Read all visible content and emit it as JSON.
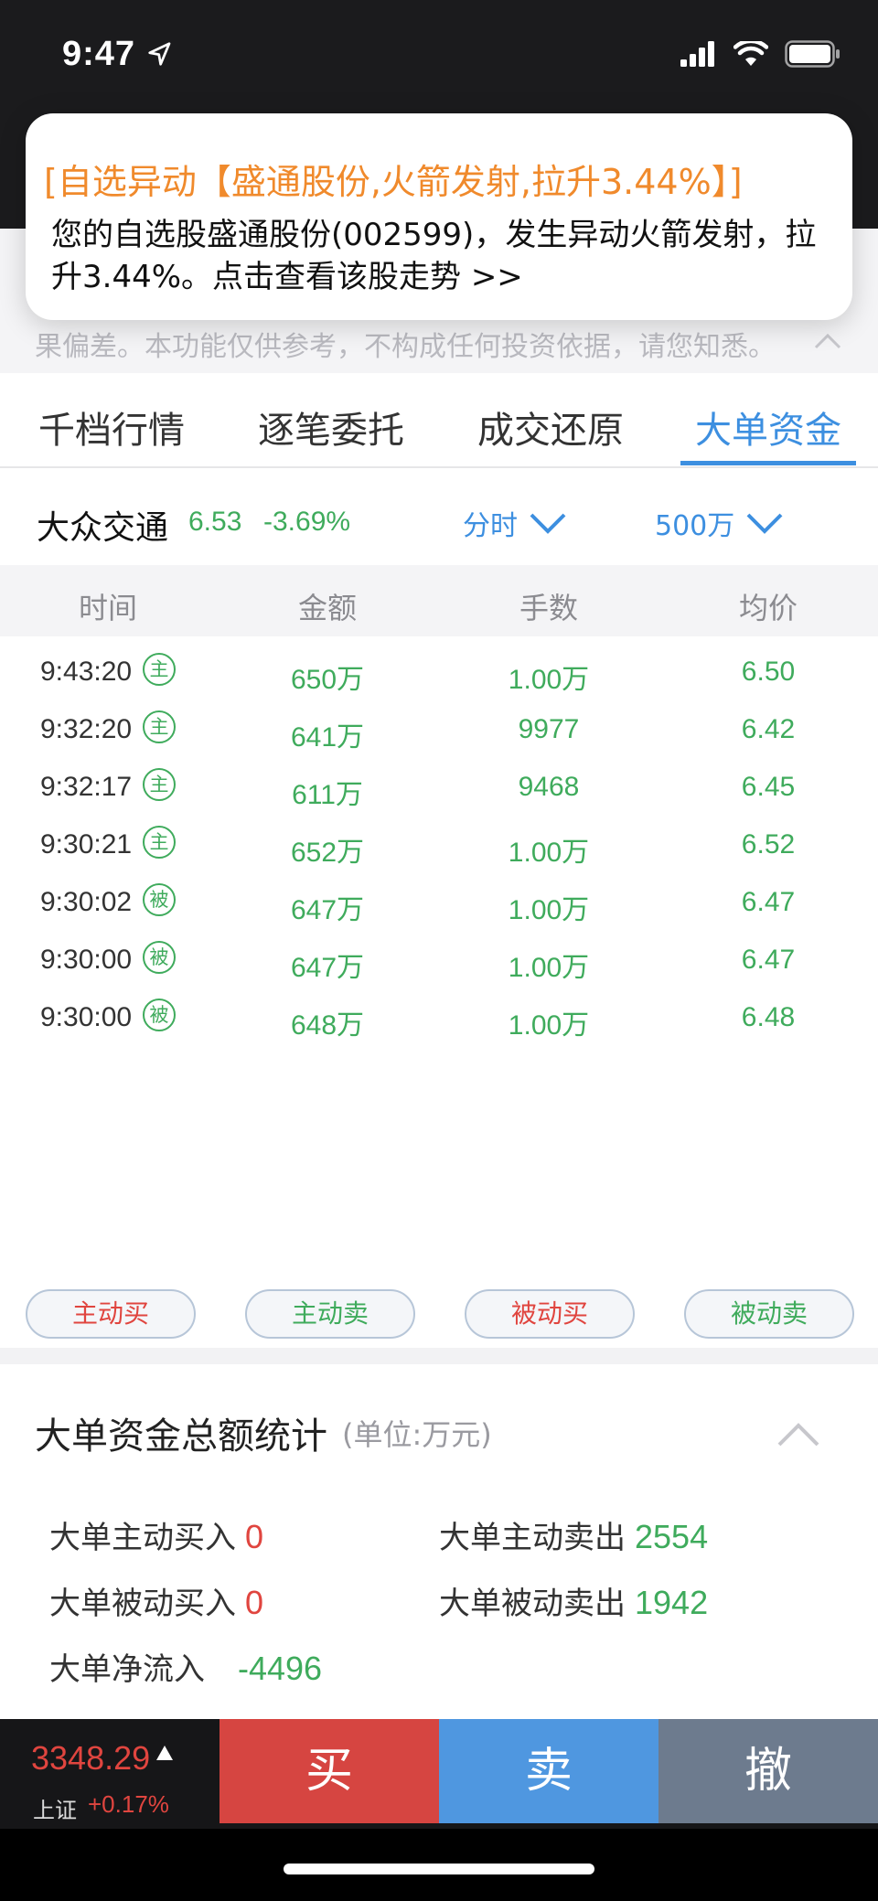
{
  "status_bar": {
    "time": "9:47"
  },
  "notification": {
    "title": "[自选异动【盛通股份,火箭发射,拉升3.44%】]",
    "body": "您的自选股盛通股份(002599)，发生异动火箭发射，拉升3.44%。点击查看该股走势 >>"
  },
  "disclaimer": "果偏差。本功能仅供参考，不构成任何投资依据，请您知悉。",
  "tabs": [
    {
      "label": "千档行情",
      "active": false
    },
    {
      "label": "逐笔委托",
      "active": false
    },
    {
      "label": "成交还原",
      "active": false
    },
    {
      "label": "大单资金",
      "active": true
    }
  ],
  "stock": {
    "name": "大众交通",
    "price": "6.53",
    "change": "-3.69%",
    "period_select": "分时",
    "threshold_select": "500万"
  },
  "table": {
    "headers": [
      "时间",
      "金额",
      "手数",
      "均价"
    ],
    "rows": [
      {
        "time": "9:43:20",
        "tag": "主",
        "amount": "650万",
        "lots": "1.00万",
        "avg": "6.50"
      },
      {
        "time": "9:32:20",
        "tag": "主",
        "amount": "641万",
        "lots": "9977",
        "avg": "6.42"
      },
      {
        "time": "9:32:17",
        "tag": "主",
        "amount": "611万",
        "lots": "9468",
        "avg": "6.45"
      },
      {
        "time": "9:30:21",
        "tag": "主",
        "amount": "652万",
        "lots": "1.00万",
        "avg": "6.52"
      },
      {
        "time": "9:30:02",
        "tag": "被",
        "amount": "647万",
        "lots": "1.00万",
        "avg": "6.47"
      },
      {
        "time": "9:30:00",
        "tag": "被",
        "amount": "647万",
        "lots": "1.00万",
        "avg": "6.47"
      },
      {
        "time": "9:30:00",
        "tag": "被",
        "amount": "648万",
        "lots": "1.00万",
        "avg": "6.48"
      }
    ]
  },
  "legend": {
    "active_buy": "主动买",
    "active_sell": "主动卖",
    "passive_buy": "被动买",
    "passive_sell": "被动卖"
  },
  "summary": {
    "title": "大单资金总额统计",
    "unit": "(单位:万元)",
    "active_buy_label": "大单主动买入",
    "active_buy_value": "0",
    "active_sell_label": "大单主动卖出",
    "active_sell_value": "2554",
    "passive_buy_label": "大单被动买入",
    "passive_buy_value": "0",
    "passive_sell_label": "大单被动卖出",
    "passive_sell_value": "1942",
    "net_label": "大单净流入",
    "net_value": "-4496"
  },
  "bottom_bar": {
    "index_value": "3348.29",
    "index_name": "上证",
    "index_change": "+0.17%",
    "buy_label": "买",
    "sell_label": "卖",
    "cancel_label": "撤"
  },
  "colors": {
    "accent_blue": "#3d8fe0",
    "up_red": "#e0453f",
    "down_green": "#3fab5c",
    "notification_orange": "#f08a2c"
  }
}
